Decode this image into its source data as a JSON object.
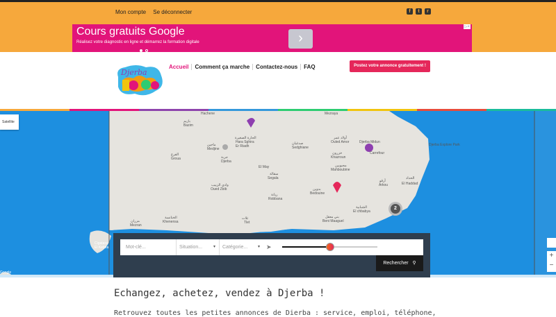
{
  "topbar": {
    "links": [
      "Mon compte",
      "Se déconnecter"
    ],
    "social_icons": [
      "facebook-icon",
      "twitter-icon",
      "rss-icon"
    ],
    "colors": {
      "background": "#f6a83c"
    }
  },
  "ad": {
    "title": "Cours gratuits Google",
    "subtitle": "Réalisez votre diagnostic en ligne et démarrez la formation digitale",
    "next_icon": "›",
    "close_label": "▷×",
    "color": "#e2147a"
  },
  "header": {
    "logo_text": "Djerba",
    "nav": [
      "Accueil",
      "Comment ça marche",
      "Contactez-nous",
      "FAQ"
    ],
    "post_button": "Postez votre annonce gratuitement !",
    "accent": "#e2147a"
  },
  "stripe_colors": [
    "#f6a83c",
    "#e2147a",
    "#8e44ad",
    "#3498db",
    "#2ecc71",
    "#f1c40f",
    "#e74c3c",
    "#1abc9c"
  ],
  "map": {
    "satellite_button": "Satellite",
    "zoom_in": "+",
    "zoom_out": "−",
    "cluster_count": "2",
    "labels": [
      "Hachene",
      "Mezraya",
      "بازيم",
      "Bazim",
      "الحارة الصغيرة",
      "Hara Sghira",
      "Er Riadh",
      "ماجين",
      "Medjine",
      "جربة",
      "Djerba",
      "الفرع",
      "Groua",
      "صدغيان",
      "Sedghiane",
      "أولاد عمر",
      "Ouled Amor",
      "Djerba Midun",
      "خزرون",
      "Khazroun",
      "محبوبين",
      "Mahboubine",
      "Carrefour",
      "Djerba Explore Park",
      "El May",
      "سقالة",
      "Segala",
      "وادي الزبيب",
      "Oued Zbib",
      "ريانة",
      "Robbana",
      "بدوين",
      "Bedouine",
      "أرقو",
      "Arkou",
      "El Haddad",
      "الحداد",
      "الخنانسة",
      "Khenensa",
      "تلات",
      "Tlet",
      "الشبابية",
      "El chbabya",
      "بني معقل",
      "Beni Maaguel",
      "مزران",
      "Mezran",
      "Cigatara",
      "El Kebira",
      "Google"
    ]
  },
  "search": {
    "keyword_placeholder": "Mot-clé...",
    "situation_placeholder": "Situation...",
    "category_placeholder": "Catégorie...",
    "button": "Rechercher",
    "slider_value_percent": 50
  },
  "content": {
    "heading": "Echangez, achetez, vendez à Djerba !",
    "intro": "Retrouvez toutes les petites annonces de Dierba : service, emploi, téléphone,"
  }
}
